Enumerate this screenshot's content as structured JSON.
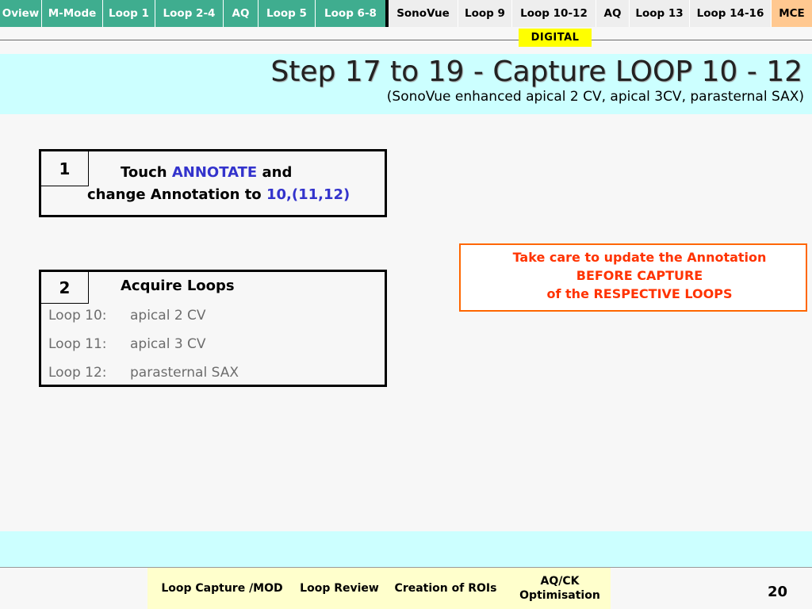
{
  "nav": {
    "tabs": [
      {
        "label": "Oview"
      },
      {
        "label": "M-Mode"
      },
      {
        "label": "Loop 1"
      },
      {
        "label": "Loop 2-4"
      },
      {
        "label": "AQ"
      },
      {
        "label": "Loop 5"
      },
      {
        "label": "Loop 6-8"
      },
      {
        "label": "SonoVue"
      },
      {
        "label": "Loop 9"
      },
      {
        "label": "Loop 10-12"
      },
      {
        "label": "AQ"
      },
      {
        "label": "Loop 13"
      },
      {
        "label": "Loop 14-16"
      },
      {
        "label": "MCE"
      }
    ],
    "badge": "DIGITAL"
  },
  "header": {
    "title": "Step 17 to 19 - Capture LOOP 10 - 12",
    "subtitle": "(SonoVue enhanced apical 2 CV, apical 3CV, parasternal SAX)"
  },
  "step1": {
    "number": "1",
    "touch": "Touch",
    "annotate": "ANNOTATE",
    "and": "and",
    "change_text": "change Annotation to",
    "value": "10,(11,12)"
  },
  "step2": {
    "number": "2",
    "heading": "Acquire Loops",
    "loops": [
      {
        "name": "Loop 10:",
        "view": "apical 2 CV"
      },
      {
        "name": "Loop 11:",
        "view": "apical 3 CV"
      },
      {
        "name": "Loop 12:",
        "view": "parasternal SAX"
      }
    ]
  },
  "warning": {
    "line1": "Take care to update the Annotation",
    "line2": "BEFORE CAPTURE",
    "line3": "of the RESPECTIVE LOOPS"
  },
  "footer": {
    "links": [
      {
        "label": "Loop Capture /MOD"
      },
      {
        "label": "Loop Review"
      },
      {
        "label": "Creation of ROIs"
      }
    ],
    "aq_line1": "AQ/CK",
    "aq_line2": "Optimisation",
    "page_number": "20"
  },
  "colors": {
    "nav_green": "#3fad8f",
    "nav_gray": "#eeeeee",
    "nav_orange": "#ffc890",
    "title_band": "#ccffff",
    "badge": "#ffff00",
    "warning": "#ff3300",
    "accent_blue": "#3333cc",
    "footer_nav": "#ffffcc"
  }
}
